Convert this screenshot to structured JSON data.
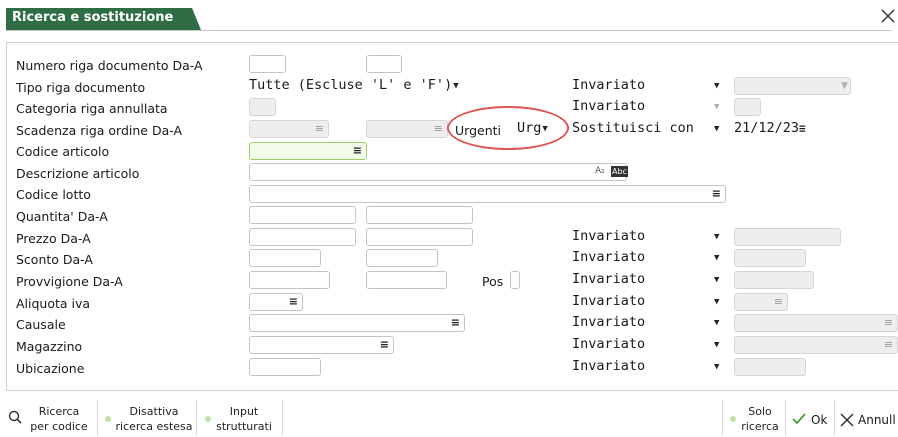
{
  "window": {
    "title": "Ricerca e sostituzione"
  },
  "labels": {
    "numero_riga": "Numero riga documento Da-A",
    "tipo_riga": "Tipo riga documento",
    "categoria_riga": "Categoria riga annullata",
    "scadenza_riga": "Scadenza riga ordine Da-A",
    "codice_articolo": "Codice articolo",
    "descrizione_articolo": "Descrizione articolo",
    "codice_lotto": "Codice lotto",
    "quantita": "Quantita' Da-A",
    "prezzo": "Prezzo Da-A",
    "sconto": "Sconto Da-A",
    "provvigione": "Provvigione Da-A",
    "aliquota": "Aliquota iva",
    "causale": "Causale",
    "magazzino": "Magazzino",
    "ubicazione": "Ubicazione",
    "urgenti": "Urgenti",
    "pos": "Pos"
  },
  "values": {
    "tipo_riga": "Tutte (Escluse 'L' e 'F')",
    "urgenti": "Urg",
    "scadenza_data": "21/12/23",
    "abc_icon_text": "Abc"
  },
  "actions": {
    "tipo_riga": "Invariato",
    "categoria_riga": "Invariato",
    "scadenza_riga": "Sostituisci con",
    "prezzo": "Invariato",
    "sconto": "Invariato",
    "provvigione": "Invariato",
    "aliquota": "Invariato",
    "causale": "Invariato",
    "magazzino": "Invariato",
    "ubicazione": "Invariato"
  },
  "toolbar": {
    "ricerca_line1": "Ricerca",
    "ricerca_line2": "per codice",
    "disattiva_line1": "Disattiva",
    "disattiva_line2": "ricerca estesa",
    "input_line1": "Input",
    "input_line2": "strutturati",
    "solo_line1": "Solo",
    "solo_line2": "ricerca",
    "ok": "Ok",
    "annulla": "Annull"
  },
  "icons": {
    "close": "close-icon",
    "search": "search-icon",
    "check": "check-icon",
    "cancel": "x-icon",
    "list": "list-icon",
    "dropdown": "chevron-down-icon"
  },
  "colors": {
    "title_bg": "#2f6e45",
    "active_border": "#9bcf6b",
    "highlight_circle": "#e05555"
  }
}
